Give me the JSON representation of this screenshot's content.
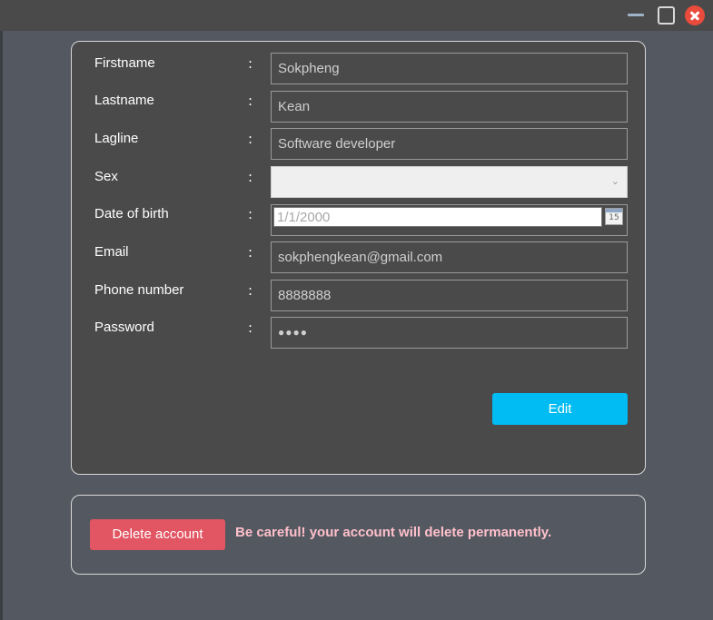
{
  "window": {
    "controls": [
      "minimize-icon",
      "maximize-icon",
      "close-icon"
    ]
  },
  "form": {
    "fields": [
      {
        "label": "Firstname",
        "colon": ":",
        "value": "Sokpheng"
      },
      {
        "label": "Lastname",
        "colon": ":",
        "value": "Kean"
      },
      {
        "label": "Lagline",
        "colon": ":",
        "value": "Software developer"
      },
      {
        "label": "Sex",
        "colon": ":",
        "value": ""
      },
      {
        "label": "Date of birth",
        "colon": ":",
        "value": "1/1/2000"
      },
      {
        "label": "Email",
        "colon": ":",
        "value": "sokphengkean@gmail.com"
      },
      {
        "label": "Phone number",
        "colon": ":",
        "value": "8888888"
      },
      {
        "label": "Password",
        "colon": ":",
        "value": "●●●●"
      }
    ],
    "calendar_day": "15",
    "edit_label": "Edit"
  },
  "danger": {
    "delete_label": "Delete account",
    "warning": "Be careful! your account will delete permanently."
  },
  "colors": {
    "background": "#545860",
    "panel": "#4a4a4a",
    "edit_button": "#00bcf2",
    "delete_button": "#e25563",
    "warning_text": "#ffc0cb"
  }
}
